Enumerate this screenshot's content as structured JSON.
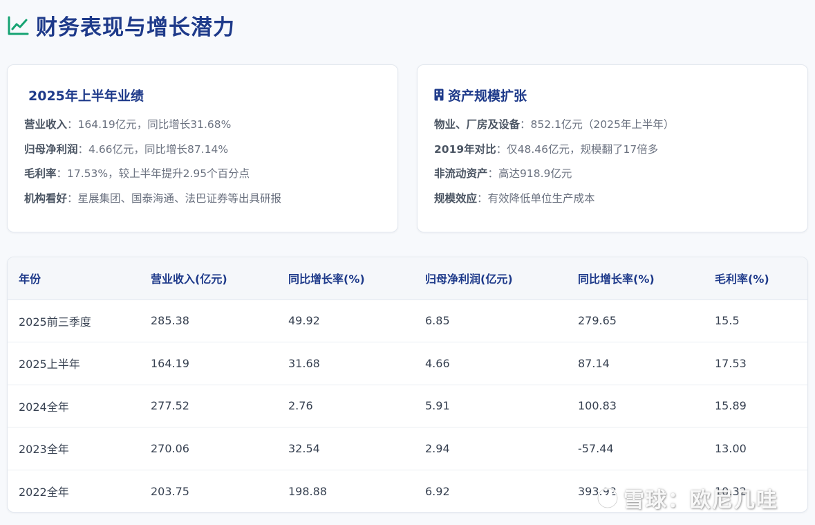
{
  "header": {
    "title": "财务表现与增长潜力",
    "icon": "chart-line-icon",
    "accent": "#1e3a8a",
    "icon_color": "#15a372"
  },
  "cards": {
    "performance": {
      "title": "2025年上半年业绩",
      "lines": [
        {
          "label": "营业收入",
          "value": "164.19亿元，同比增长31.68%"
        },
        {
          "label": "归母净利润",
          "value": "4.66亿元，同比增长87.14%"
        },
        {
          "label": "毛利率",
          "value": "17.53%，较上半年提升2.95个百分点"
        },
        {
          "label": "机构看好",
          "value": "星展集团、国泰海通、法巴证券等出具研报"
        }
      ]
    },
    "assets": {
      "title": "资产规模扩张",
      "icon": "building-icon",
      "lines": [
        {
          "label": "物业、厂房及设备",
          "value": "852.1亿元（2025年上半年）"
        },
        {
          "label": "2019年对比",
          "value": "仅48.46亿元，规模翻了17倍多"
        },
        {
          "label": "非流动资产",
          "value": "高达918.9亿元"
        },
        {
          "label": "规模效应",
          "value": "有效降低单位生产成本"
        }
      ]
    }
  },
  "table": {
    "headers": [
      "年份",
      "营业收入(亿元)",
      "同比增长率(%)",
      "归母净利润(亿元)",
      "同比增长率(%)",
      "毛利率(%)"
    ],
    "rows": [
      [
        "2025前三季度",
        "285.38",
        "49.92",
        "6.85",
        "279.65",
        "15.5"
      ],
      [
        "2025上半年",
        "164.19",
        "31.68",
        "4.66",
        "87.14",
        "17.53"
      ],
      [
        "2024全年",
        "277.52",
        "2.76",
        "5.91",
        "100.83",
        "15.89"
      ],
      [
        "2023全年",
        "270.06",
        "32.54",
        "2.94",
        "-57.44",
        "13.00"
      ],
      [
        "2022全年",
        "203.75",
        "198.88",
        "6.92",
        "393.92",
        "10.32"
      ]
    ]
  },
  "watermark": {
    "text": "雪球：欧尼几哇",
    "icon": "xueqiu-logo-icon"
  }
}
